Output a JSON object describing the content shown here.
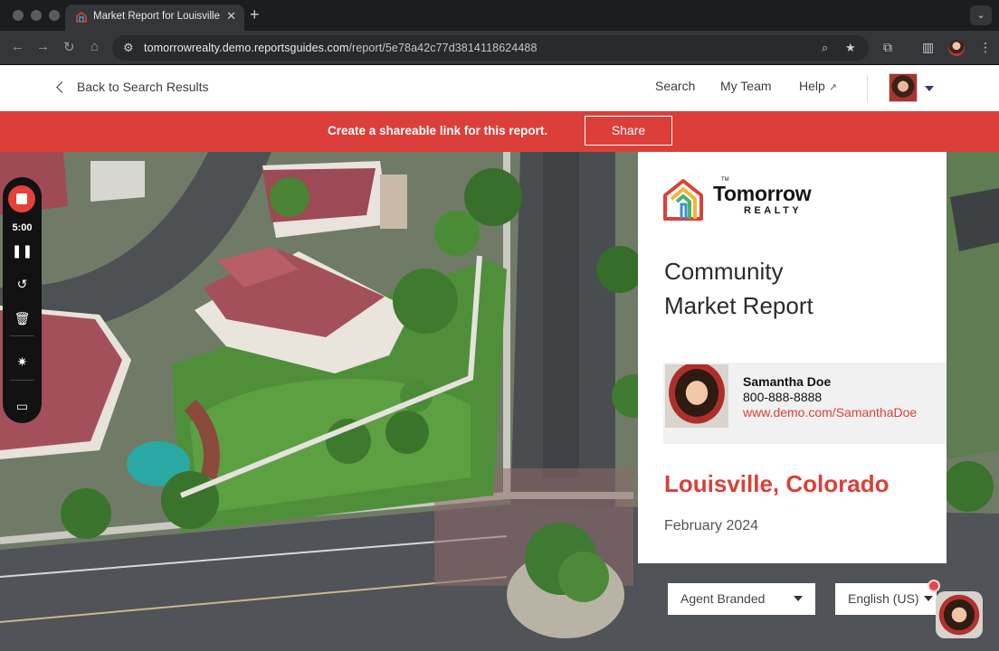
{
  "browser": {
    "tab_title": "Market Report for Louisville",
    "tab_close": "✕",
    "new_tab": "+",
    "tab_menu": "⌄",
    "url_host": "tomorrowrealty.demo.reportsguides.com",
    "url_path": "/report/5e78a42c77d3814118624488",
    "icons": [
      "back-arrow-icon",
      "forward-arrow-icon",
      "reload-icon",
      "home-icon",
      "site-settings-icon",
      "zoom-icon",
      "bookmark-star-icon",
      "extensions-icon",
      "side-panel-icon",
      "profile-avatar",
      "more-menu-icon"
    ]
  },
  "header": {
    "back_label": "Back to Search Results",
    "nav": {
      "search": "Search",
      "team": "My Team",
      "help": "Help"
    }
  },
  "banner": {
    "text": "Create a shareable link for this report.",
    "share_label": "Share",
    "color": "#dc3f39"
  },
  "recorder": {
    "time": "5:00",
    "icons": [
      "stop-record-icon",
      "pause-icon",
      "restart-icon",
      "trash-icon",
      "effects-icon",
      "camera-icon"
    ]
  },
  "report": {
    "brand_name": "Tomorrow",
    "brand_sub": "REALTY",
    "brand_tm": "TM",
    "title_line1": "Community",
    "title_line2": "Market Report",
    "agent": {
      "name": "Samantha Doe",
      "phone": "800-888-8888",
      "website": "www.demo.com/SamanthaDoe"
    },
    "location": "Louisville, Colorado",
    "date": "February 2024",
    "accent": "#dc3f39"
  },
  "controls": {
    "branding_select": "Agent Branded",
    "language_select": "English (US)"
  }
}
